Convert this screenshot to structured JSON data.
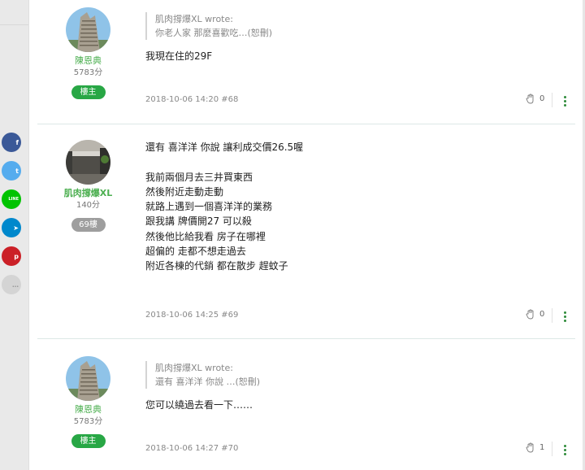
{
  "share_buttons": [
    {
      "icon": "facebook-icon",
      "glyph": "f",
      "color": "#3b5998"
    },
    {
      "icon": "twitter-icon",
      "glyph": "t",
      "color": "#55acee"
    },
    {
      "icon": "line-icon",
      "glyph": "LINE",
      "color": "#00c300"
    },
    {
      "icon": "telegram-icon",
      "glyph": "➤",
      "color": "#0088cc"
    },
    {
      "icon": "pinterest-icon",
      "glyph": "p",
      "color": "#cb2027"
    },
    {
      "icon": "more-share-icon",
      "glyph": "…",
      "color": "#d4d4d4"
    }
  ],
  "posts": [
    {
      "author": {
        "name": "陳恩典",
        "points": "5783分",
        "badge": "樓主",
        "avatar_icon": "building-avatar"
      },
      "quote": {
        "header": "肌肉撐爆XL wrote:",
        "text": "你老人家 那麼喜歡吃…(恕刪)"
      },
      "body": [
        "我現在住的29F"
      ],
      "meta": "2018-10-06 14:20 #68",
      "likes": "0"
    },
    {
      "author": {
        "name": "肌肉撐爆XL",
        "points": "140分",
        "badge": "69樓",
        "avatar_icon": "photo-avatar"
      },
      "body": [
        "還有 喜洋洋 你說 讓利成交價26.5喔",
        "",
        "我前兩個月去三井買東西",
        "然後附近走動走動",
        "就路上遇到一個喜洋洋的業務",
        "跟我講 牌價開27 可以殺",
        "然後他比給我看 房子在哪裡",
        "超偏的 走都不想走過去",
        "附近各棟的代銷 都在散步 趕蚊子"
      ],
      "meta": "2018-10-06 14:25 #69",
      "likes": "0"
    },
    {
      "author": {
        "name": "陳恩典",
        "points": "5783分",
        "badge": "樓主",
        "avatar_icon": "building-avatar"
      },
      "quote": {
        "header": "肌肉撐爆XL wrote:",
        "text": "還有 喜洋洋 你說 …(恕刪)"
      },
      "body": [
        "您可以繞過去看一下……"
      ],
      "meta": "2018-10-06 14:27 #70",
      "likes": "1"
    }
  ]
}
